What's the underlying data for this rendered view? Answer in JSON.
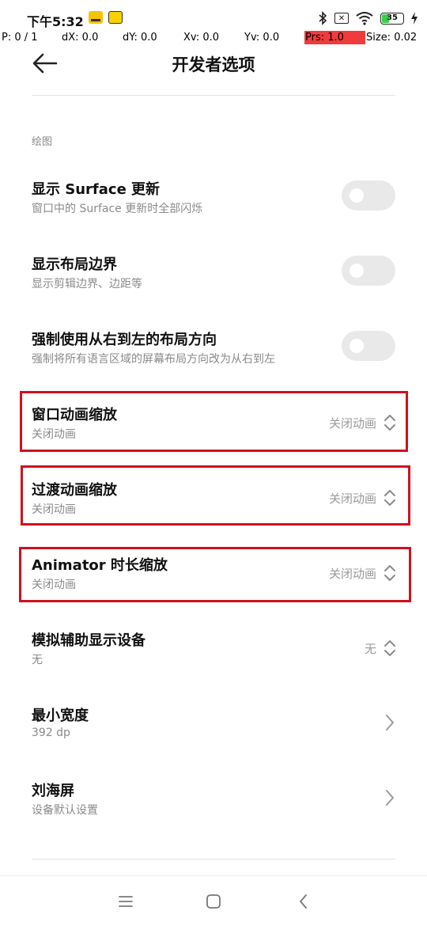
{
  "status_bar": {
    "time": "下午5:32",
    "battery_level": "35",
    "colors": {
      "battery_fill": "#3ccf4e"
    }
  },
  "pointer_overlay": {
    "p": "P: 0 / 1",
    "dx": "dX: 0.0",
    "dy": "dY: 0.0",
    "xv": "Xv: 0.0",
    "yv": "Yv: 0.0",
    "prs": "Prs: 1.0",
    "size": "Size: 0.02",
    "prs_color": "#ef3b3b"
  },
  "header": {
    "back_icon": "arrow-left-icon",
    "title": "开发者选项"
  },
  "section": {
    "label": "绘图"
  },
  "rows": [
    {
      "title": "显示 Surface 更新",
      "subtitle": "窗口中的 Surface 更新时全部闪烁",
      "control": "toggle",
      "on": false
    },
    {
      "title": "显示布局边界",
      "subtitle": "显示剪辑边界、边距等",
      "control": "toggle",
      "on": false
    },
    {
      "title": "强制使用从右到左的布局方向",
      "subtitle": "强制将所有语言区域的屏幕布局方向改为从右到左",
      "control": "toggle",
      "on": false
    },
    {
      "title": "窗口动画缩放",
      "subtitle": "关闭动画",
      "control": "select",
      "value": "关闭动画",
      "highlighted": true
    },
    {
      "title": "过渡动画缩放",
      "subtitle": "关闭动画",
      "control": "select",
      "value": "关闭动画",
      "highlighted": true
    },
    {
      "title": "Animator 时长缩放",
      "subtitle": "关闭动画",
      "control": "select",
      "value": "关闭动画",
      "highlighted": true
    },
    {
      "title": "模拟辅助显示设备",
      "subtitle": "无",
      "control": "select",
      "value": "无"
    },
    {
      "title": "最小宽度",
      "subtitle": "392 dp",
      "control": "chevron"
    },
    {
      "title": "刘海屏",
      "subtitle": "设备默认设置",
      "control": "chevron"
    }
  ],
  "highlight_color": "#d0101e",
  "nav_bar": {
    "icons": [
      "menu-icon",
      "home-icon",
      "back-icon"
    ]
  }
}
